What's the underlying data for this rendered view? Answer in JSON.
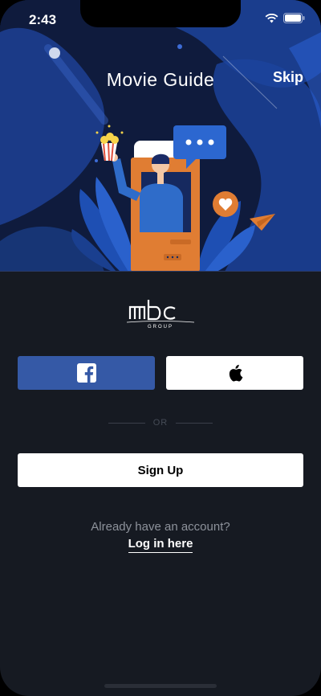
{
  "status_bar": {
    "time": "2:43"
  },
  "header": {
    "title": "Movie Guide",
    "skip_label": "Skip"
  },
  "brand": {
    "logo_text": "mbc",
    "logo_subtext": "GROUP"
  },
  "social": {
    "facebook_icon": "facebook-icon",
    "apple_icon": "apple-icon"
  },
  "divider": {
    "or_label": "OR"
  },
  "actions": {
    "signup_label": "Sign Up"
  },
  "footer": {
    "prompt": "Already have an account?",
    "login_label": "Log in here"
  },
  "colors": {
    "hero_bg": "#0f1b3d",
    "hero_blue": "#1f4aa8",
    "facebook": "#3559a6",
    "orange": "#e07d33",
    "page_bg": "#161a22"
  }
}
